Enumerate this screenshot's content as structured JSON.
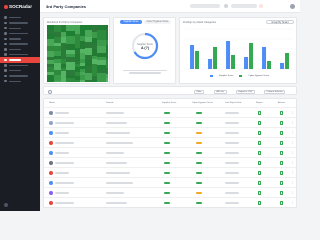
{
  "app": {
    "brand": "SOCRadar"
  },
  "page": {
    "title": "3rd Party Companies"
  },
  "colors": {
    "accent": "#e8453c",
    "blue": "#4e8df5",
    "green": "#34a853",
    "orange": "#f5a623",
    "sidebar": "#1a1d24"
  },
  "sidebar": {
    "items": [
      {
        "icon": "dashboard-icon",
        "active": false
      },
      {
        "icon": "shield-icon",
        "active": false
      },
      {
        "icon": "globe-icon",
        "active": false
      },
      {
        "icon": "bug-icon",
        "active": false
      },
      {
        "icon": "eye-icon",
        "active": false
      },
      {
        "icon": "search-icon",
        "active": false
      },
      {
        "icon": "target-icon",
        "active": false
      },
      {
        "icon": "building-icon",
        "active": false
      },
      {
        "icon": "companies-icon",
        "active": true
      },
      {
        "icon": "folder-icon",
        "active": false
      },
      {
        "icon": "users-icon",
        "active": false
      },
      {
        "icon": "report-icon",
        "active": false
      },
      {
        "icon": "gear-icon",
        "active": false
      }
    ]
  },
  "cards": {
    "treemap": {
      "title": "Monitored 3rd Party Companies"
    },
    "donut": {
      "tabs": [
        "Supplier Score",
        "Cyber Hygiene Score"
      ],
      "label": "Supplier Score",
      "value": "A (?)"
    },
    "bars": {
      "title": "Findings by Attack Categories",
      "dropdown": "Group By Tenant",
      "legend": [
        "Supplier Score",
        "Cyber Hygiene Score"
      ],
      "series": [
        {
          "color": "#4e8df5",
          "values": [
            60,
            25,
            70,
            30,
            55,
            15
          ]
        },
        {
          "color": "#34a853",
          "values": [
            45,
            55,
            35,
            65,
            20,
            40
          ]
        }
      ]
    }
  },
  "filters": {
    "buttons": [
      "Filter",
      "All Lists",
      "Export to CSV",
      "Column Selector"
    ]
  },
  "table": {
    "columns": [
      "Name",
      "Domain",
      "Supplier Score",
      "Cyber Hygiene Score",
      "Last Report Date",
      "Report",
      "Actions"
    ],
    "rows": [
      {
        "avatar": "#7c8aa8",
        "s1": "#34a853",
        "s2": "#34a853",
        "s3": "#34a853"
      },
      {
        "avatar": "#8fa3c8",
        "s1": "#34a853",
        "s2": "#34a853",
        "s3": "#34a853"
      },
      {
        "avatar": "#4e8df5",
        "s1": "#34a853",
        "s2": "#f5a623",
        "s3": "#34a853"
      },
      {
        "avatar": "#e8453c",
        "s1": "#34a853",
        "s2": "#f5a623",
        "s3": "#34a853"
      },
      {
        "avatar": "#4e8df5",
        "s1": "#34a853",
        "s2": "#34a853",
        "s3": "#34a853"
      },
      {
        "avatar": "#6b7280",
        "s1": "#34a853",
        "s2": "#34a853",
        "s3": "#34a853"
      },
      {
        "avatar": "#e8453c",
        "s1": "#34a853",
        "s2": "#34a853",
        "s3": "#34a853"
      },
      {
        "avatar": "#4e8df5",
        "s1": "#34a853",
        "s2": "#34a853",
        "s3": "#34a853"
      },
      {
        "avatar": "#8b5cf6",
        "s1": "#34a853",
        "s2": "#f5a623",
        "s3": "#34a853"
      },
      {
        "avatar": "#e8453c",
        "s1": "#34a853",
        "s2": "#34a853",
        "s3": "#34a853"
      }
    ]
  }
}
